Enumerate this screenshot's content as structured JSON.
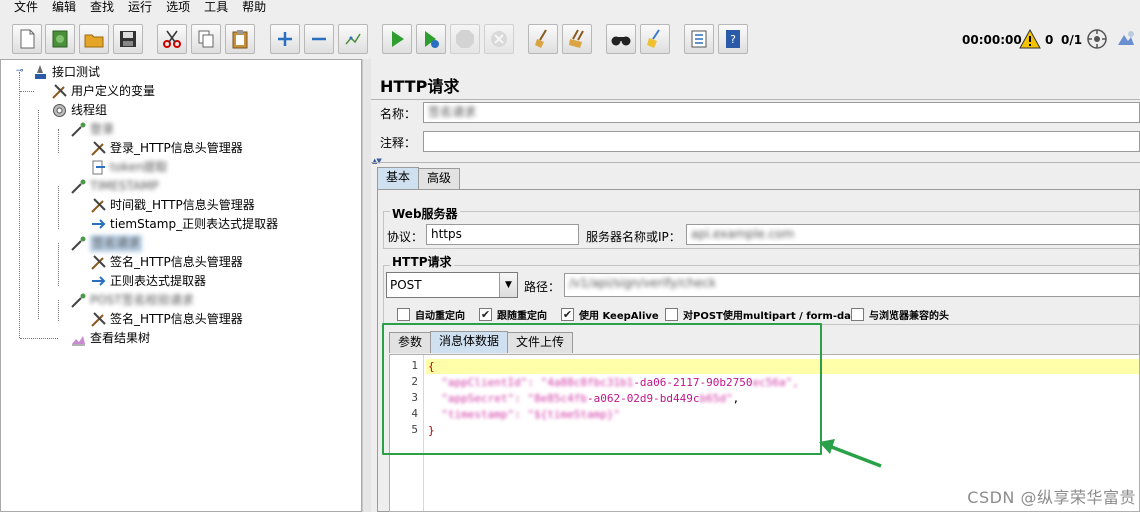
{
  "menu": [
    "文件",
    "编辑",
    "查找",
    "运行",
    "选项",
    "工具",
    "帮助"
  ],
  "toolbar": {
    "buttons": [
      "new-icon",
      "template-icon",
      "open-icon",
      "save-icon",
      "cut-icon",
      "copy-icon",
      "paste-icon",
      "expand-icon",
      "collapse-icon",
      "toggle-icon",
      "start-icon",
      "start-no-pause-icon",
      "stop-icon",
      "shutdown-icon",
      "clear-icon",
      "clear-all-icon",
      "search-icon",
      "reset-search-icon",
      "function-helper-icon",
      "help-icon"
    ],
    "timer": "00:00:00",
    "error_count": "0",
    "threads": "0/1"
  },
  "tree": {
    "root": "接口测试",
    "user_vars": "用户定义的变量",
    "thread_group": "线程组",
    "sampler1": "登录",
    "sampler1_header": "登录_HTTP信息头管理器",
    "sampler1_extract": "token提取",
    "sampler2": "TIMESTAMP",
    "sampler2_header": "时间戳_HTTP信息头管理器",
    "sampler2_extract": "tiemStamp_正则表达式提取器",
    "sampler3": "签名请求",
    "sampler3_header": "签名_HTTP信息头管理器",
    "sampler3_extract": "正则表达式提取器",
    "sampler4": "POST签名校验请求",
    "sampler4_header": "签名_HTTP信息头管理器",
    "result_tree": "查看结果树"
  },
  "panel": {
    "title": "HTTP请求",
    "name_label": "名称：",
    "name_value": "签名请求",
    "comment_label": "注释：",
    "comment_value": "",
    "tabs": [
      "基本",
      "高级"
    ],
    "web_server_title": "Web服务器",
    "protocol_label": "协议：",
    "protocol_value": "https",
    "server_label": "服务器名称或IP：",
    "server_value": "api.example.com",
    "http_request_title": "HTTP请求",
    "method_value": "POST",
    "path_label": "路径：",
    "path_value": "/v1/api/sign/verify/check",
    "checkboxes": [
      {
        "label": "自动重定向",
        "checked": false
      },
      {
        "label": "跟随重定向",
        "checked": true
      },
      {
        "label": "使用 KeepAlive",
        "checked": true
      },
      {
        "label": "对POST使用multipart / form-data",
        "checked": false
      },
      {
        "label": "与浏览器兼容的头",
        "checked": false
      }
    ],
    "body_tabs": [
      "参数",
      "消息体数据",
      "文件上传"
    ],
    "body_lines": [
      {
        "num": "1",
        "parts": [
          {
            "t": "{",
            "c": "brace"
          }
        ]
      },
      {
        "num": "2",
        "parts": [
          {
            "t": "  ",
            "c": ""
          },
          {
            "t": "\"appClientId\": \"4a88c8fbc31b1",
            "c": "blur"
          },
          {
            "t": "-da06-2117-90b2750",
            "c": "str"
          },
          {
            "t": "ec56a\",",
            "c": "blur"
          }
        ]
      },
      {
        "num": "3",
        "parts": [
          {
            "t": "  ",
            "c": ""
          },
          {
            "t": "\"appSecret\": \"8e85c4fb",
            "c": "blur"
          },
          {
            "t": "-a062-02d9-bd449c",
            "c": "str"
          },
          {
            "t": "b65d\"",
            "c": "blur"
          },
          {
            "t": ",",
            "c": ""
          }
        ]
      },
      {
        "num": "4",
        "parts": [
          {
            "t": "  ",
            "c": ""
          },
          {
            "t": "\"timestamp\": \"${timeStamp}\"",
            "c": "blur"
          }
        ]
      },
      {
        "num": "5",
        "parts": [
          {
            "t": "}",
            "c": "brace"
          }
        ]
      }
    ]
  },
  "watermark": "CSDN @纵享荣华富贵"
}
